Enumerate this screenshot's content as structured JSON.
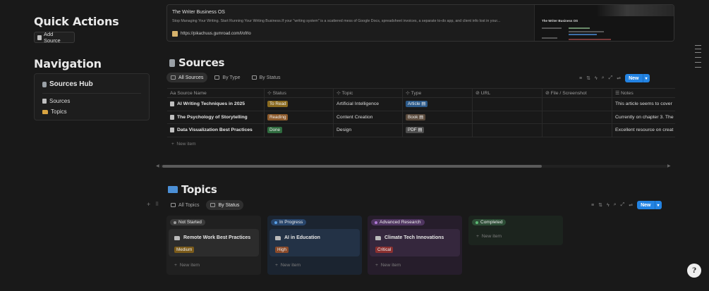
{
  "left": {
    "quick_actions_title": "Quick Actions",
    "add_source_label": "Add Source",
    "navigation_title": "Navigation",
    "hub_title": "Sources Hub",
    "nav_items": [
      "Sources",
      "Topics"
    ]
  },
  "bookmark": {
    "title": "The Writer Business OS",
    "description": "Stop Managing Your Writing. Start Running Your Writing Business.If your \"writing system\" is a scattered mess of Google Docs, spreadsheet invoices, a separate to-do app, and client info lost in your...",
    "url": "https://pikachuus.gumroad.com/l/ofrlo",
    "thumb_title": "The Writer Business OS"
  },
  "sources": {
    "title": "Sources",
    "tabs": [
      "All Sources",
      "By Type",
      "By Status"
    ],
    "new_label": "New",
    "columns": [
      "Source Name",
      "Status",
      "Topic",
      "Type",
      "URL",
      "File / Screenshot",
      "Notes"
    ],
    "rows": [
      {
        "name": "AI Writing Techniques in 2025",
        "status": "To Read",
        "topic": "Artificial Intelligence",
        "type": "Article",
        "notes": "This article seems to cover"
      },
      {
        "name": "The Psychology of Storytelling",
        "status": "Reading",
        "topic": "Content Creation",
        "type": "Book",
        "notes": "Currently on chapter 3. The"
      },
      {
        "name": "Data Visualization Best Practices",
        "status": "Done",
        "topic": "Design",
        "type": "PDF",
        "notes": "Excellent resource on creat"
      }
    ],
    "new_item": "New item",
    "colors": {
      "to_read": "#8a6a1f",
      "reading": "#8d5a2b",
      "done": "#2f6b3f",
      "article": "#2c5a8a",
      "book": "#5a4a3c",
      "pdf": "#4d4d4d"
    }
  },
  "topics": {
    "title": "Topics",
    "tabs": [
      "All Topics",
      "By Status"
    ],
    "new_label": "New",
    "columns": [
      {
        "status": "Not Started",
        "card": "Remote Work Best Practices",
        "tag": "Medium",
        "new_item": "New item"
      },
      {
        "status": "In Progress",
        "card": "AI in Education",
        "tag": "High",
        "new_item": "New item"
      },
      {
        "status": "Advanced Research",
        "card": "Climate Tech Innovations",
        "tag": "Critical",
        "new_item": "New item"
      },
      {
        "status": "Completed",
        "card": "",
        "tag": "",
        "new_item": "New item"
      }
    ]
  },
  "help_label": "?"
}
